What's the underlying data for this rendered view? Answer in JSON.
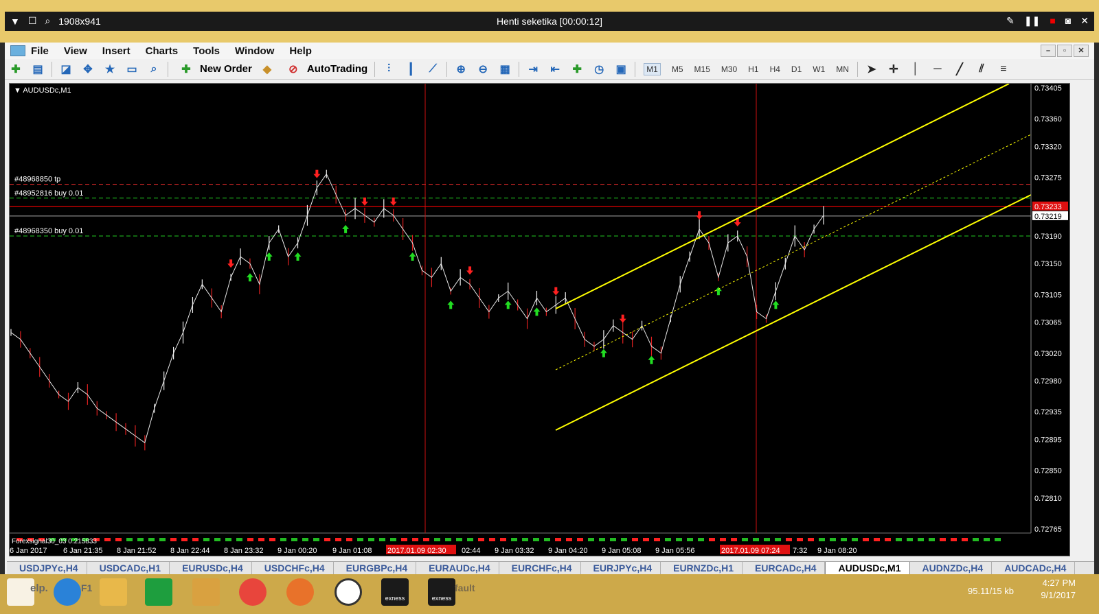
{
  "remote": {
    "resolution": "1908x941",
    "title": "Henti seketika [00:00:12]"
  },
  "menu": [
    "File",
    "View",
    "Insert",
    "Charts",
    "Tools",
    "Window",
    "Help"
  ],
  "toolbar": {
    "new_order": "New Order",
    "autotrading": "AutoTrading",
    "timeframes": [
      "M1",
      "M5",
      "M15",
      "M30",
      "H1",
      "H4",
      "D1",
      "W1",
      "MN"
    ],
    "active_timeframe": "M1"
  },
  "chart": {
    "symbol_label": "AUDUSDc,M1",
    "order_labels": {
      "tp": "#48968850 tp",
      "buy1": "#48952816 buy 0.01",
      "buy2": "#48968350 buy 0.01"
    },
    "indicator_label": "Forexsignal30_03 0.215833",
    "bid_price": "0.73233",
    "ask_price": "0.73219",
    "colors": {
      "background": "#000000",
      "bull_arrow": "#22dd22",
      "bear_arrow": "#ff2020",
      "channel": "#ffff00",
      "price_line": "#ff0000"
    }
  },
  "chart_data": {
    "type": "line",
    "title": "AUDUSDc,M1",
    "xlabel": "",
    "ylabel": "",
    "y_ticks": [
      "0.73405",
      "0.73360",
      "0.73320",
      "0.73275",
      "0.73233",
      "0.73219",
      "0.73190",
      "0.73150",
      "0.73105",
      "0.73065",
      "0.73020",
      "0.72980",
      "0.72935",
      "0.72895",
      "0.72850",
      "0.72810",
      "0.72765"
    ],
    "ylim": [
      0.72765,
      0.73405
    ],
    "x_ticks": [
      "6 Jan 2017",
      "6 Jan 21:35",
      "8 Jan 21:52",
      "8 Jan 22:44",
      "8 Jan 23:32",
      "9 Jan 00:20",
      "9 Jan 01:08",
      "2017.01.09 02:30",
      "02:44",
      "9 Jan 03:32",
      "9 Jan 04:20",
      "9 Jan 05:08",
      "9 Jan 05:56",
      "2017.01.09 07:24",
      "7:32",
      "9 Jan 08:20"
    ],
    "crosshair_times": [
      "2017.01.09 02:30",
      "2017.01.09 07:24"
    ],
    "series": [
      {
        "name": "",
        "y": [
          0.7305,
          0.7304,
          0.7302,
          0.73,
          0.7298,
          0.7296,
          0.7295,
          0.7297,
          0.7296,
          0.7294,
          0.7293,
          0.7292,
          0.7291,
          0.729,
          0.7289,
          0.7294,
          0.7298,
          0.7302,
          0.7305,
          0.7309,
          0.7312,
          0.731,
          0.7308,
          0.7313,
          0.7316,
          0.7315,
          0.7312,
          0.7318,
          0.732,
          0.7316,
          0.7318,
          0.7322,
          0.7326,
          0.7328,
          0.7325,
          0.7322,
          0.7323,
          0.7322,
          0.7321,
          0.7323,
          0.7322,
          0.732,
          0.7318,
          0.7314,
          0.7313,
          0.7315,
          0.7311,
          0.7313,
          0.7312,
          0.731,
          0.7308,
          0.731,
          0.7311,
          0.7309,
          0.7307,
          0.731,
          0.7308,
          0.7309,
          0.731,
          0.7307,
          0.7304,
          0.7303,
          0.7304,
          0.7306,
          0.7305,
          0.7304,
          0.7306,
          0.7303,
          0.7302,
          0.7307,
          0.7312,
          0.7316,
          0.732,
          0.7318,
          0.7313,
          0.7318,
          0.7319,
          0.7316,
          0.7308,
          0.7307,
          0.7311,
          0.7315,
          0.7319,
          0.7317,
          0.732,
          0.7322
        ]
      }
    ],
    "horizontal_levels": [
      {
        "name": "#48968850 tp",
        "y": 0.73265
      },
      {
        "name": "#48952816 buy 0.01",
        "y": 0.73245
      },
      {
        "name": "#48968350 buy 0.01",
        "y": 0.7319
      }
    ],
    "grid": false
  },
  "tabs": [
    "USDJPYc,H4",
    "USDCADc,H1",
    "EURUSDc,H4",
    "USDCHFc,H4",
    "EURGBPc,H4",
    "EURAUDc,H4",
    "EURCHFc,H4",
    "EURJPYc,H4",
    "EURNZDc,H1",
    "EURCADc,H4",
    "AUDUSDc,M1",
    "AUDNZDc,H4",
    "AUDCADc,H4"
  ],
  "active_tab": "AUDUSDc,M1",
  "taskbar": {
    "help_label": "elp.",
    "f1_label": "F1",
    "default_label": "fault",
    "exness_label": "exness",
    "tray_net": "95.11/15 kb",
    "time": "4:27 PM",
    "date": "9/1/2017"
  }
}
